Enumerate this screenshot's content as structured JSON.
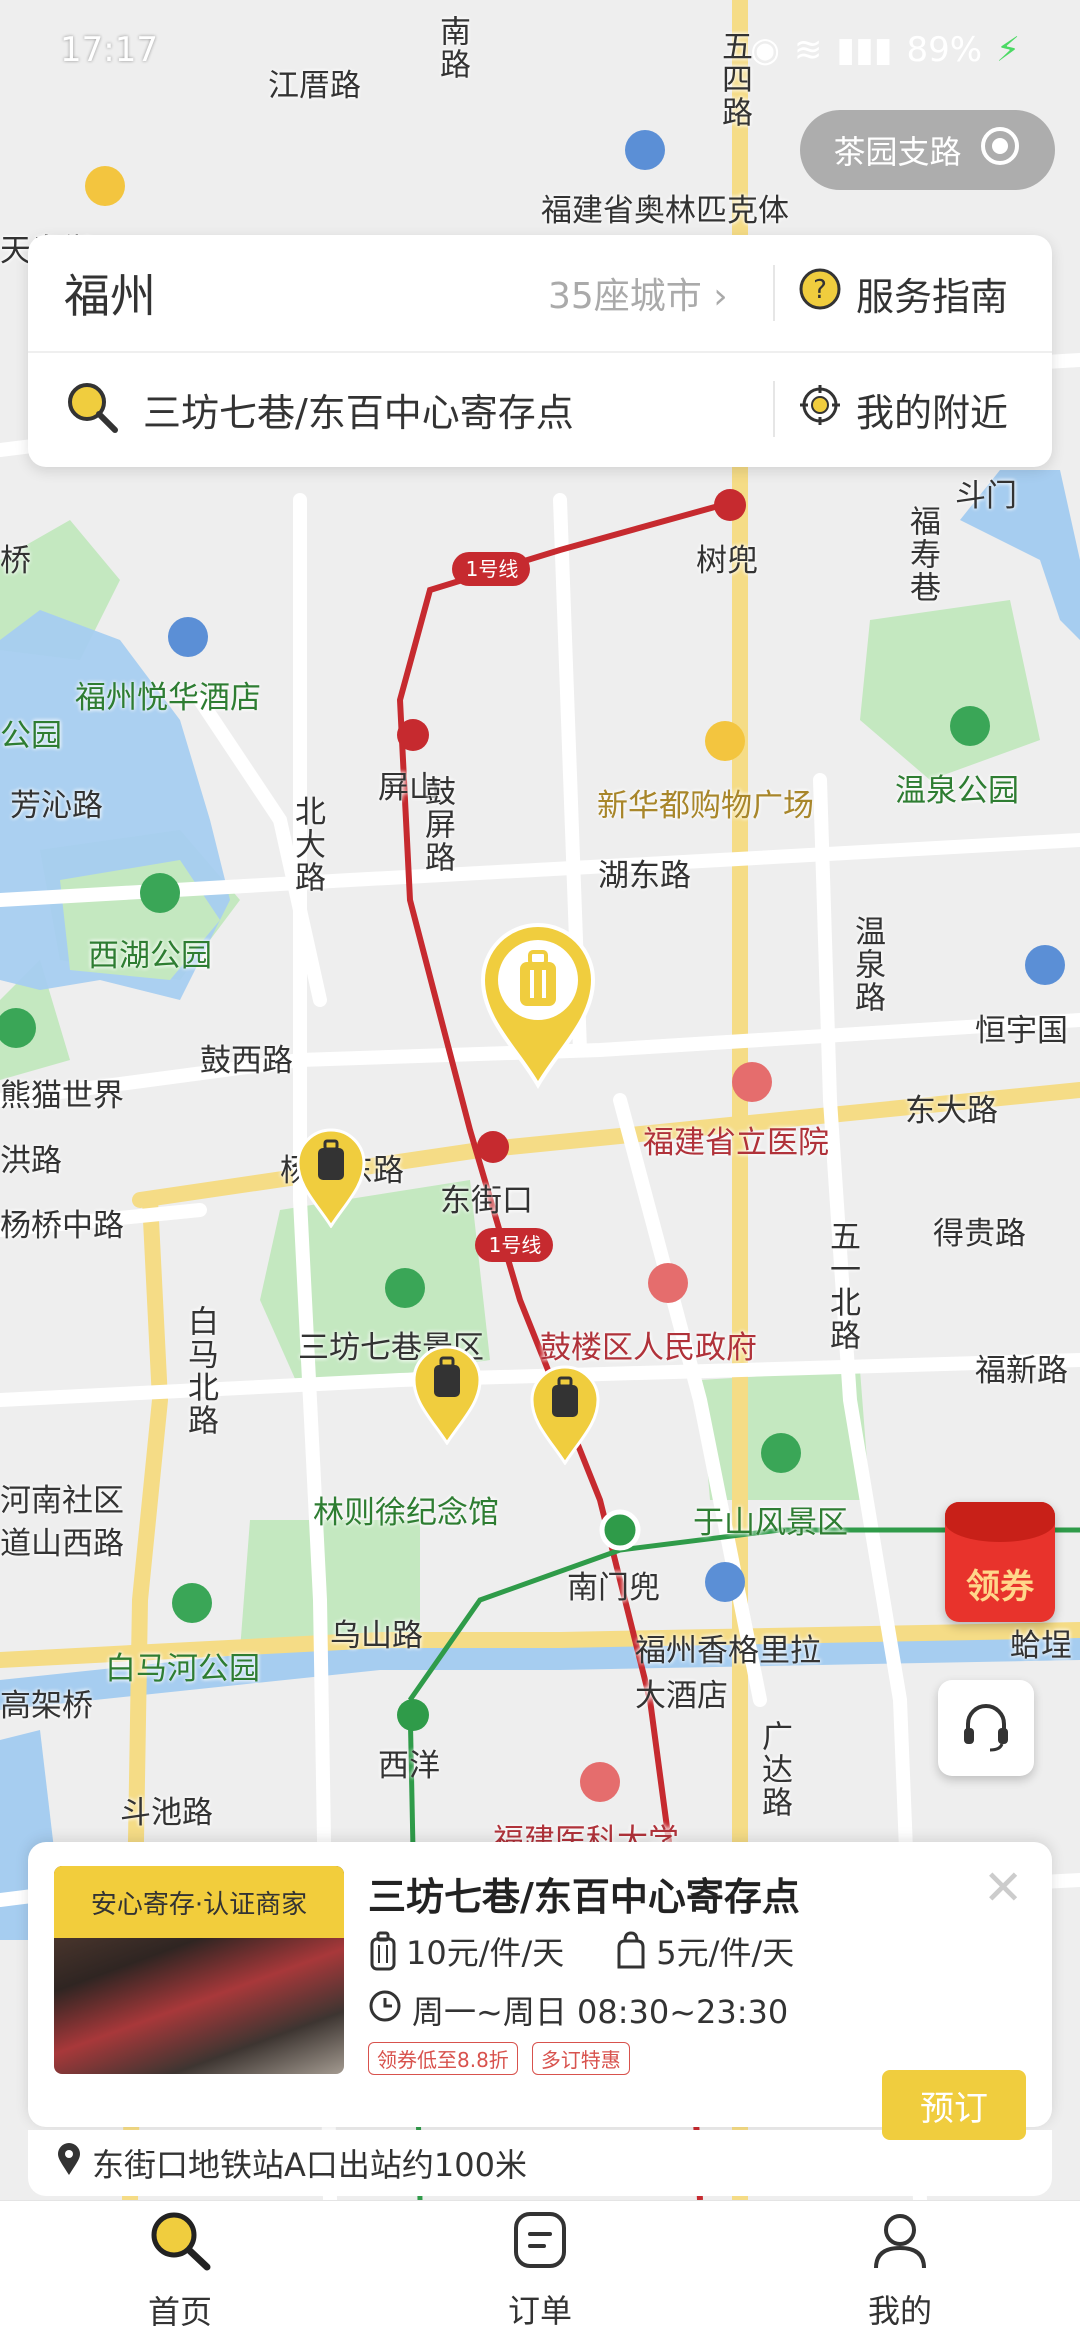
{
  "status_bar": {
    "time": "17:17",
    "battery": "89%"
  },
  "top_location": {
    "label": "茶园支路"
  },
  "search": {
    "city": "福州",
    "city_count": "35座城市",
    "guide_label": "服务指南",
    "query": "三坊七巷/东百中心寄存点",
    "nearby_label": "我的附近"
  },
  "map": {
    "labels": {
      "jiangcuo": "江厝路",
      "wusi": "五四路",
      "nanlu": "南路",
      "olympic": "福建省奥林匹克体育中心",
      "shuniu": "树兜",
      "doumen": "斗门",
      "fushou": "福寿巷",
      "line1": "1号线",
      "yuehua": "福州悦华酒店",
      "pingshan": "屏山",
      "guping": "鼓屏路",
      "xinhuadu": "新华都购物广场",
      "wenquan": "温泉公园",
      "fangqin": "芳沁路",
      "beida": "北大路",
      "hudong": "湖东路",
      "xihu": "西湖公园",
      "wenquanlu": "温泉路",
      "hengyu": "恒宇国",
      "guxi": "鼓西路",
      "xiongmao": "熊猫世界",
      "shengli": "福建省立医院",
      "dongda": "东大路",
      "dongjiekou": "东街口",
      "yangqiao": "杨桥东路",
      "yangqiaozhong": "杨桥中路",
      "wuyi": "五一北路",
      "deigui": "得贵路",
      "baima": "白马北路",
      "sanfang": "三坊七巷景区",
      "gulou": "鼓楼区人民政府",
      "fuxin": "福新路",
      "henan": "河南社区",
      "daoshan": "道山西路",
      "linzexu": "林则徐纪念馆",
      "yushan": "于山风景区",
      "nanmen": "南门兜",
      "xianggeli": "福州香格里拉大酒店",
      "baimahe": "白马河公园",
      "wushan": "乌山路",
      "xiyang": "西洋",
      "guangda": "广达路",
      "yike": "福建医科大学",
      "gaojia": "高架桥",
      "douchi": "斗池路",
      "baozi": "蛤埕",
      "gongyuan": "公园",
      "ho": "洪路",
      "qiao": "桥",
      "tianjie": "天泉街"
    }
  },
  "coupon": {
    "label": "领券"
  },
  "store": {
    "badge": "安心寄存·认证商家",
    "name": "三坊七巷/东百中心寄存点",
    "price_large": "10元/件/天",
    "price_small": "5元/件/天",
    "hours": "周一~周日 08:30~23:30",
    "tags": [
      "领券低至8.8折",
      "多订特惠"
    ],
    "location": "东街口地铁站A口出站约100米",
    "book_label": "预订"
  },
  "nav": {
    "items": [
      {
        "label": "首页",
        "active": true
      },
      {
        "label": "订单",
        "active": false
      },
      {
        "label": "我的",
        "active": false
      }
    ]
  },
  "colors": {
    "accent": "#f2cd3c",
    "metro": "#c62a2f",
    "park": "#c4e8c0",
    "water": "#a6cdf0"
  }
}
